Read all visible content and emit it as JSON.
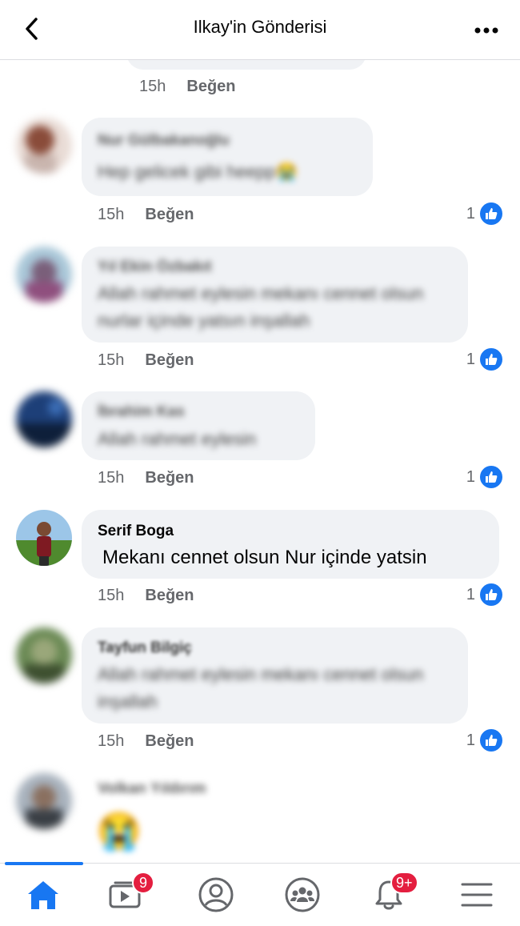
{
  "header": {
    "title": "Ilkay'in Gönderisi"
  },
  "comments": [
    {
      "time": "15h",
      "like_label": "Beğen",
      "name": "",
      "text": ""
    },
    {
      "time": "15h",
      "like_label": "Beğen",
      "name": "Nur Gülbakanoğlu",
      "text": "Hep gelicek gibi heepp😭",
      "reactions": "1"
    },
    {
      "time": "15h",
      "like_label": "Beğen",
      "name": "Yıl Ekin Özbakıt",
      "text": "Allah rahmet eylesin mekanı cennet olsun nurlar içinde yatsın inşallah",
      "reactions": "1"
    },
    {
      "time": "15h",
      "like_label": "Beğen",
      "name": "İbrahim Kas",
      "text": "Allah rahmet eylesin",
      "reactions": "1"
    },
    {
      "time": "15h",
      "like_label": "Beğen",
      "name": "Serif Boga",
      "text": "Mekanı cennet olsun Nur içinde yatsin",
      "reactions": "1"
    },
    {
      "time": "15h",
      "like_label": "Beğen",
      "name": "Tayfun Bilgiç",
      "text": "Allah rahmet eylesin mekanı cennet olsun inşallah",
      "reactions": "1"
    },
    {
      "time": "",
      "like_label": "",
      "name": "Volkan Yıldırım",
      "text": "😭"
    }
  ],
  "tabbar": {
    "video_badge": "9",
    "notifications_badge": "9+"
  },
  "colors": {
    "accent": "#1877f2",
    "badge": "#e41e3f",
    "bubble": "#f0f2f5",
    "meta": "#65676b"
  }
}
